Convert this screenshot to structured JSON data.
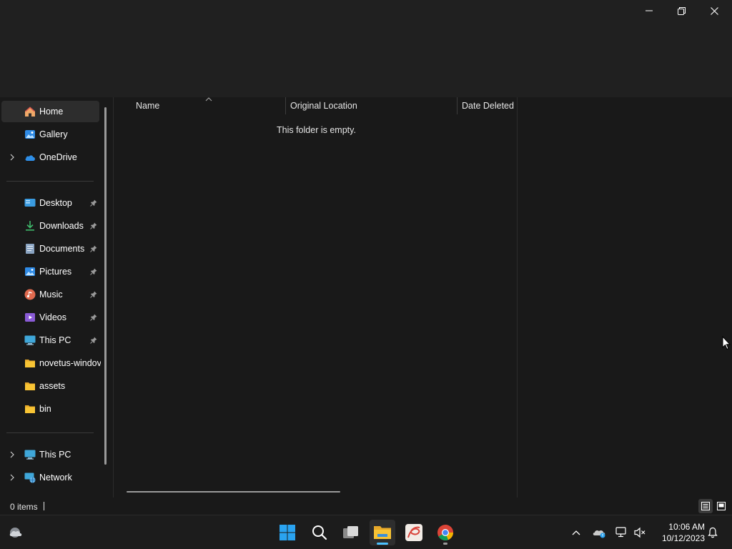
{
  "window": {
    "minimize_label": "Minimize",
    "maximize_label": "Restore",
    "close_label": "Close"
  },
  "nav": {
    "items": [
      {
        "label": "Home",
        "icon": "home-icon",
        "pinned": false,
        "expandable": false,
        "selected": true
      },
      {
        "label": "Gallery",
        "icon": "gallery-icon",
        "pinned": false,
        "expandable": false
      },
      {
        "label": "OneDrive",
        "icon": "onedrive-icon",
        "pinned": false,
        "expandable": true
      },
      {
        "label": "Desktop",
        "icon": "desktop-icon",
        "pinned": true
      },
      {
        "label": "Downloads",
        "icon": "downloads-icon",
        "pinned": true
      },
      {
        "label": "Documents",
        "icon": "documents-icon",
        "pinned": true
      },
      {
        "label": "Pictures",
        "icon": "pictures-icon",
        "pinned": true
      },
      {
        "label": "Music",
        "icon": "music-icon",
        "pinned": true
      },
      {
        "label": "Videos",
        "icon": "videos-icon",
        "pinned": true
      },
      {
        "label": "This PC",
        "icon": "this-pc-icon",
        "pinned": true
      },
      {
        "label": "novetus-windov",
        "icon": "folder-icon",
        "pinned": false
      },
      {
        "label": "assets",
        "icon": "folder-icon",
        "pinned": false
      },
      {
        "label": "bin",
        "icon": "folder-icon",
        "pinned": false
      },
      {
        "label": "This PC",
        "icon": "this-pc-icon",
        "expandable": true
      },
      {
        "label": "Network",
        "icon": "network-icon",
        "expandable": true
      }
    ]
  },
  "content": {
    "columns": {
      "name": "Name",
      "original_location": "Original Location",
      "date_deleted": "Date Deleted"
    },
    "empty_message": "This folder is empty."
  },
  "status": {
    "item_count": "0 items"
  },
  "taskbar": {
    "time": "10:06 AM",
    "date": "10/12/2023",
    "apps": [
      "start-icon",
      "search-icon",
      "task-view-icon",
      "file-explorer-icon",
      "app-icon",
      "chrome-icon"
    ]
  },
  "colors": {
    "background": "#191919",
    "titlebar": "#202020",
    "accent": "#4cc2ff",
    "selected": "#2d2d2d",
    "folder": "#f8c434"
  }
}
